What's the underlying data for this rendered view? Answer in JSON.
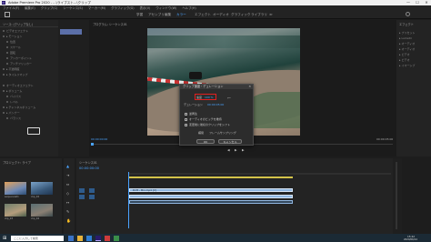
{
  "titlebar": {
    "title": "Adobe Premiere Pro 2020 - ...\\ライブスト...\\クリップ",
    "minimize": "—",
    "maximize": "☐",
    "close": "✕"
  },
  "menu": [
    "ファイル(F)",
    "編集(E)",
    "クリップ(C)",
    "シーケンス(S)",
    "マーカー(M)",
    "グラフィック(G)",
    "表示(V)",
    "ウィンドウ(W)",
    "ヘルプ(H)"
  ],
  "workspaces": [
    "学習",
    "アセンブリ",
    "編集",
    "カラー",
    "エフェクト",
    "オーディオ",
    "グラフィック",
    "ライブラリ",
    "≫"
  ],
  "active_workspace_index": 3,
  "source_panel": {
    "tab_label": "ソース: (クリップなし)",
    "rows": [
      "ビデオエフェクト",
      "▸ モーション",
      "位置",
      "スケール",
      "回転",
      "アンカーポイント",
      "アンチフリッカー",
      "▸ 不透明度",
      "▸ タイムリマップ",
      "オーディオエフェクト",
      "▸ ボリューム",
      "バイパス",
      "レベル",
      "▸ チャンネルボリューム",
      "▸ パンナー",
      "バランス"
    ]
  },
  "program_panel": {
    "tab_label": "プログラム: シーケンス01",
    "timecode_left": "00:00:00:00",
    "fit": "全体表示",
    "timecode_right": "00:00:05:00"
  },
  "effects_panel": {
    "tab_label": "エフェクト",
    "items": [
      "▸ プリセット",
      "▸ Lumetri",
      "▸ オーディオ",
      "▸ オーディオ",
      "▸ ビデオ",
      "▸ ビデオ",
      "▸ イマーシブ"
    ]
  },
  "dialog": {
    "title": "クリップ速度・デュレーション",
    "close": "✕",
    "speed_label": "速度",
    "speed_value": "100 %",
    "duration_label": "デュレーション",
    "duration_value": "00:00:05:00",
    "checkbox_reverse": "逆再生",
    "checkbox_pitch": "オーディオのピッチを維持",
    "checkbox_ripple": "変更後に後続のクリップをシフト",
    "interp_label": "補間",
    "interp_value": "フレームサンプリング",
    "ok": "OK",
    "cancel": "キャンセル"
  },
  "project_panel": {
    "tab_label": "プロジェクト: ライブ",
    "clips": [
      "sequence01",
      "clip_02",
      "clip_03",
      "clip_04"
    ]
  },
  "timeline_panel": {
    "tab_label": "シーケンス01",
    "timecode": "00:00:00:00",
    "clip_label": "Drift - Mix.mp4 [V]"
  },
  "taskbar": {
    "search_placeholder": "ここに入力して検索",
    "time": "15:42",
    "date": "2020/06/14"
  },
  "colors": {
    "accent": "#4aa3ff",
    "dialog_highlight": "#e02020",
    "clip_blue": "#8fb6e0"
  }
}
